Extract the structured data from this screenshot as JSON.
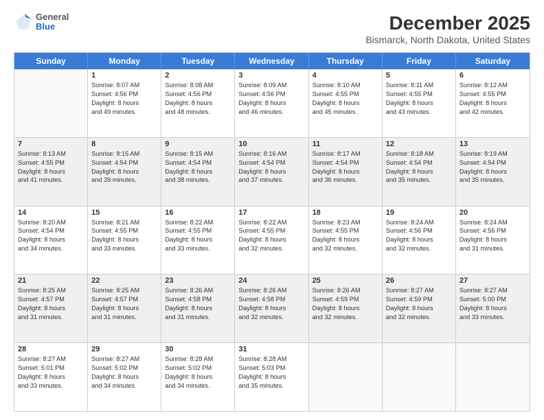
{
  "logo": {
    "general": "General",
    "blue": "Blue"
  },
  "title": "December 2025",
  "subtitle": "Bismarck, North Dakota, United States",
  "days": [
    "Sunday",
    "Monday",
    "Tuesday",
    "Wednesday",
    "Thursday",
    "Friday",
    "Saturday"
  ],
  "weeks": [
    [
      {
        "day": "",
        "lines": []
      },
      {
        "day": "1",
        "lines": [
          "Sunrise: 8:07 AM",
          "Sunset: 4:56 PM",
          "Daylight: 8 hours",
          "and 49 minutes."
        ]
      },
      {
        "day": "2",
        "lines": [
          "Sunrise: 8:08 AM",
          "Sunset: 4:56 PM",
          "Daylight: 8 hours",
          "and 48 minutes."
        ]
      },
      {
        "day": "3",
        "lines": [
          "Sunrise: 8:09 AM",
          "Sunset: 4:56 PM",
          "Daylight: 8 hours",
          "and 46 minutes."
        ]
      },
      {
        "day": "4",
        "lines": [
          "Sunrise: 8:10 AM",
          "Sunset: 4:55 PM",
          "Daylight: 8 hours",
          "and 45 minutes."
        ]
      },
      {
        "day": "5",
        "lines": [
          "Sunrise: 8:11 AM",
          "Sunset: 4:55 PM",
          "Daylight: 8 hours",
          "and 43 minutes."
        ]
      },
      {
        "day": "6",
        "lines": [
          "Sunrise: 8:12 AM",
          "Sunset: 4:55 PM",
          "Daylight: 8 hours",
          "and 42 minutes."
        ]
      }
    ],
    [
      {
        "day": "7",
        "lines": [
          "Sunrise: 8:13 AM",
          "Sunset: 4:55 PM",
          "Daylight: 8 hours",
          "and 41 minutes."
        ]
      },
      {
        "day": "8",
        "lines": [
          "Sunrise: 8:15 AM",
          "Sunset: 4:54 PM",
          "Daylight: 8 hours",
          "and 39 minutes."
        ]
      },
      {
        "day": "9",
        "lines": [
          "Sunrise: 8:15 AM",
          "Sunset: 4:54 PM",
          "Daylight: 8 hours",
          "and 38 minutes."
        ]
      },
      {
        "day": "10",
        "lines": [
          "Sunrise: 8:16 AM",
          "Sunset: 4:54 PM",
          "Daylight: 8 hours",
          "and 37 minutes."
        ]
      },
      {
        "day": "11",
        "lines": [
          "Sunrise: 8:17 AM",
          "Sunset: 4:54 PM",
          "Daylight: 8 hours",
          "and 36 minutes."
        ]
      },
      {
        "day": "12",
        "lines": [
          "Sunrise: 8:18 AM",
          "Sunset: 4:54 PM",
          "Daylight: 8 hours",
          "and 35 minutes."
        ]
      },
      {
        "day": "13",
        "lines": [
          "Sunrise: 8:19 AM",
          "Sunset: 4:54 PM",
          "Daylight: 8 hours",
          "and 35 minutes."
        ]
      }
    ],
    [
      {
        "day": "14",
        "lines": [
          "Sunrise: 8:20 AM",
          "Sunset: 4:54 PM",
          "Daylight: 8 hours",
          "and 34 minutes."
        ]
      },
      {
        "day": "15",
        "lines": [
          "Sunrise: 8:21 AM",
          "Sunset: 4:55 PM",
          "Daylight: 8 hours",
          "and 33 minutes."
        ]
      },
      {
        "day": "16",
        "lines": [
          "Sunrise: 8:22 AM",
          "Sunset: 4:55 PM",
          "Daylight: 8 hours",
          "and 33 minutes."
        ]
      },
      {
        "day": "17",
        "lines": [
          "Sunrise: 8:22 AM",
          "Sunset: 4:55 PM",
          "Daylight: 8 hours",
          "and 32 minutes."
        ]
      },
      {
        "day": "18",
        "lines": [
          "Sunrise: 8:23 AM",
          "Sunset: 4:55 PM",
          "Daylight: 8 hours",
          "and 32 minutes."
        ]
      },
      {
        "day": "19",
        "lines": [
          "Sunrise: 8:24 AM",
          "Sunset: 4:56 PM",
          "Daylight: 8 hours",
          "and 32 minutes."
        ]
      },
      {
        "day": "20",
        "lines": [
          "Sunrise: 8:24 AM",
          "Sunset: 4:56 PM",
          "Daylight: 8 hours",
          "and 31 minutes."
        ]
      }
    ],
    [
      {
        "day": "21",
        "lines": [
          "Sunrise: 8:25 AM",
          "Sunset: 4:57 PM",
          "Daylight: 8 hours",
          "and 31 minutes."
        ]
      },
      {
        "day": "22",
        "lines": [
          "Sunrise: 8:25 AM",
          "Sunset: 4:57 PM",
          "Daylight: 8 hours",
          "and 31 minutes."
        ]
      },
      {
        "day": "23",
        "lines": [
          "Sunrise: 8:26 AM",
          "Sunset: 4:58 PM",
          "Daylight: 8 hours",
          "and 31 minutes."
        ]
      },
      {
        "day": "24",
        "lines": [
          "Sunrise: 8:26 AM",
          "Sunset: 4:58 PM",
          "Daylight: 8 hours",
          "and 32 minutes."
        ]
      },
      {
        "day": "25",
        "lines": [
          "Sunrise: 8:26 AM",
          "Sunset: 4:59 PM",
          "Daylight: 8 hours",
          "and 32 minutes."
        ]
      },
      {
        "day": "26",
        "lines": [
          "Sunrise: 8:27 AM",
          "Sunset: 4:59 PM",
          "Daylight: 8 hours",
          "and 32 minutes."
        ]
      },
      {
        "day": "27",
        "lines": [
          "Sunrise: 8:27 AM",
          "Sunset: 5:00 PM",
          "Daylight: 8 hours",
          "and 33 minutes."
        ]
      }
    ],
    [
      {
        "day": "28",
        "lines": [
          "Sunrise: 8:27 AM",
          "Sunset: 5:01 PM",
          "Daylight: 8 hours",
          "and 33 minutes."
        ]
      },
      {
        "day": "29",
        "lines": [
          "Sunrise: 8:27 AM",
          "Sunset: 5:02 PM",
          "Daylight: 8 hours",
          "and 34 minutes."
        ]
      },
      {
        "day": "30",
        "lines": [
          "Sunrise: 8:28 AM",
          "Sunset: 5:02 PM",
          "Daylight: 8 hours",
          "and 34 minutes."
        ]
      },
      {
        "day": "31",
        "lines": [
          "Sunrise: 8:28 AM",
          "Sunset: 5:03 PM",
          "Daylight: 8 hours",
          "and 35 minutes."
        ]
      },
      {
        "day": "",
        "lines": []
      },
      {
        "day": "",
        "lines": []
      },
      {
        "day": "",
        "lines": []
      }
    ]
  ]
}
